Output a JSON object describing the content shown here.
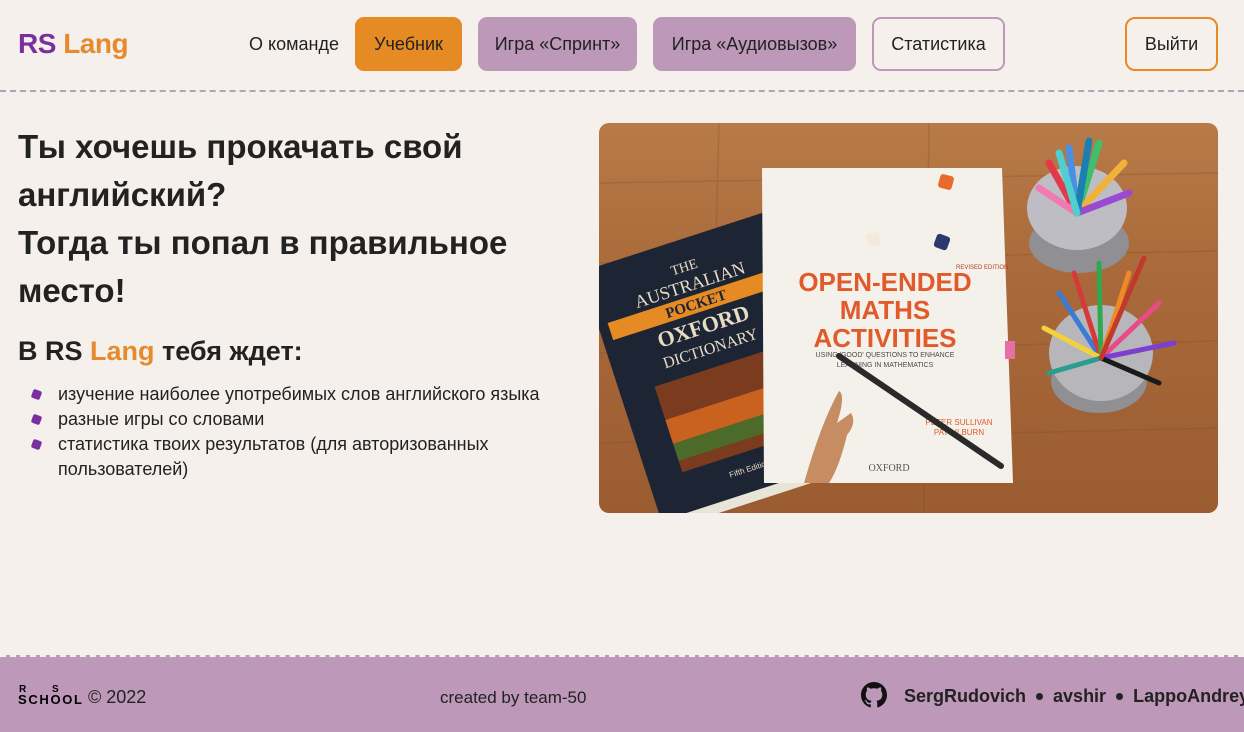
{
  "header": {
    "logo_rs": "RS",
    "logo_lang": "Lang",
    "nav": {
      "about": "О команде",
      "textbook": "Учебник",
      "sprint": "Игра «Спринт»",
      "audiocall": "Игра «Аудиовызов»",
      "statistics": "Статистика"
    },
    "logout": "Выйти"
  },
  "main": {
    "title_line1": "Ты хочешь прокачать свой английский?",
    "title_line2": "Тогда ты попал в правильное место!",
    "subtitle_prefix": "В RS",
    "subtitle_lang": "Lang",
    "subtitle_suffix": "тебя ждет:",
    "features": [
      "изучение наиболее употребимых слов английского языка",
      "разные игры со словами",
      "статистика твоих результатов (для авторизованных пользователей)"
    ],
    "image": {
      "book1_line1": "THE",
      "book1_line2": "AUSTRALIAN",
      "book1_line3": "POCKET",
      "book1_line4": "OXFORD",
      "book1_line5": "DICTIONARY",
      "book1_edition": "Fifth Edition",
      "book2_line1": "OPEN-ENDED",
      "book2_line2": "MATHS",
      "book2_line3": "ACTIVITIES",
      "book2_tag": "REVISED EDITION",
      "book2_subtitle1": "USING 'GOOD' QUESTIONS TO ENHANCE",
      "book2_subtitle2": "LEARNING IN MATHEMATICS",
      "book2_author1": "PETER SULLIVAN",
      "book2_author2": "PAT LILBURN",
      "book2_publisher": "OXFORD"
    }
  },
  "footer": {
    "rs_school_r": "R",
    "rs_school_s": "S",
    "rs_school_word": "SCHOOL",
    "copyright": "© 2022",
    "created_by": "created by team-50",
    "authors": [
      "SergRudovich",
      "avshir",
      "LappoAndrey"
    ]
  },
  "colors": {
    "background": "#f5f0ec",
    "accent_orange": "#e68a24",
    "accent_purple": "#7a2f9e",
    "nav_purple": "#bd98b9"
  }
}
